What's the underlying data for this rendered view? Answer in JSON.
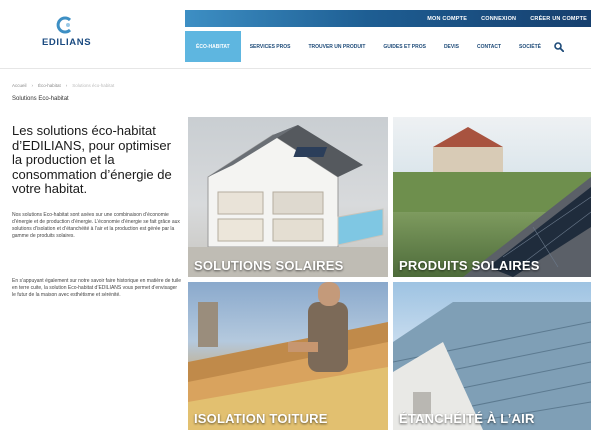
{
  "logo": {
    "text": "EDILIANS",
    "colors": {
      "mark_blue": "#3d8fc4",
      "word": "#1a4a80"
    }
  },
  "topbar": {
    "links": [
      "MON COMPTE",
      "CONNEXION",
      "CRÉER UN COMPTE"
    ]
  },
  "nav": {
    "items": [
      "ÉCO-HABITAT",
      "SERVICES PROS",
      "TROUVER UN PRODUIT",
      "GUIDES ET PROS",
      "DEVIS",
      "CONTACT",
      "SOCIÉTÉ"
    ],
    "active_index": 0,
    "search_icon": "search-icon"
  },
  "breadcrumb": {
    "items": [
      "Accueil",
      "Éco-habitat",
      "Solutions éco-habitat"
    ]
  },
  "page": {
    "subtitle": "Solutions Eco-habitat",
    "heading": "Les solutions éco-habitat d’EDILIANS, pour optimiser la production et la consommation d’énergie de votre habitat.",
    "paragraph1": "Nos solutions Eco-habitat sont axées sur une combinaison d’économie d’énergie et de production d’énergie. L’économie d’énergie se fait grâce aux solutions d’isolation et d’étanchéité à l’air et la production est gérée par la gamme de produits solaires.",
    "paragraph2": "En s’appuyant également sur notre savoir faire historique en matière de tuile en terre cuite, la solution Eco-habitat d’EDILIANS vous permet d’envisager le futur de la maison avec esthétisme et sérénité."
  },
  "tiles": [
    {
      "label": "SOLUTIONS SOLAIRES"
    },
    {
      "label": "PRODUITS SOLAIRES"
    },
    {
      "label": "ISOLATION TOITURE"
    },
    {
      "label": "ÉTANCHÉITÉ À L’AIR"
    }
  ],
  "colors": {
    "topbar_start": "#3d8fc4",
    "topbar_end": "#163f6e",
    "nav_active": "#5eb6e0",
    "nav_text": "#1d4a78"
  }
}
